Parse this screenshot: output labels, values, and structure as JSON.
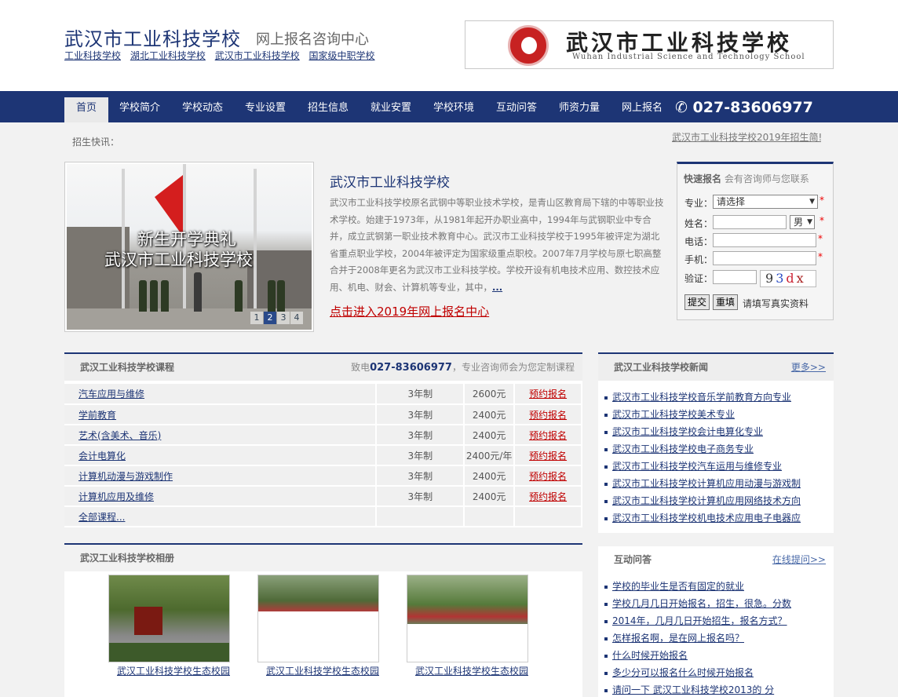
{
  "header": {
    "title": "武汉市工业科技学校",
    "subtitle": "网上报名咨询中心",
    "links": [
      "工业科技学校",
      "湖北工业科技学校",
      "武汉市工业科技学校",
      "国家级中职学校"
    ],
    "logo_cn": "武汉市工业科技学校",
    "logo_en": "Wuhan Industrial Science and Technology School"
  },
  "nav": {
    "items": [
      "首页",
      "学校简介",
      "学校动态",
      "专业设置",
      "招生信息",
      "就业安置",
      "学校环境",
      "互动问答",
      "师资力量",
      "网上报名"
    ],
    "phone": "027-83606977"
  },
  "news_ticker": {
    "label": "招生快讯：",
    "text": "武汉市工业科技学校2019年招生简!"
  },
  "slideshow": {
    "caption_line1": "新生开学典礼",
    "caption_line2": "武汉市工业科技学校",
    "pages": [
      "1",
      "2",
      "3",
      "4"
    ],
    "active_page": 2
  },
  "intro": {
    "title": "武汉市工业科技学校",
    "text": "武汉市工业科技学校原名武钢中等职业技术学校，是青山区教育局下辖的中等职业技术学校。始建于1973年，从1981年起开办职业高中，1994年与武钢职业中专合并，成立武钢第一职业技术教育中心。武汉市工业科技学校于1995年被评定为湖北省重点职业学校，2004年被评定为国家级重点职校。2007年7月学校与原七职高整合并于2008年更名为武汉市工业科技学校。学校开设有机电技术应用、数控技术应用、机电、财会、计算机等专业，其中，",
    "more": "...",
    "link": "点击进入2019年网上报名中心"
  },
  "quick_form": {
    "title": "快速报名",
    "subtitle": "会有咨询师与您联系",
    "major_label": "专业：",
    "major_value": "请选择",
    "name_label": "姓名：",
    "gender_value": "男",
    "phone_label": "电话：",
    "mobile_label": "手机：",
    "captcha_label": "验证：",
    "captcha_chars": [
      "9",
      "3",
      "d",
      "x"
    ],
    "submit": "提交",
    "reset": "重填",
    "hint": "请填写真实资料",
    "required_mark": "*"
  },
  "courses": {
    "title": "武汉工业科技学校课程",
    "phone_prefix": "致电",
    "phone": "027-83606977",
    "phone_suffix": "，专业咨询师会为您定制课程",
    "rows": [
      {
        "name": "汽车应用与维修",
        "duration": "3年制",
        "price": "2600元",
        "action": "预约报名"
      },
      {
        "name": "学前教育",
        "duration": "3年制",
        "price": "2400元",
        "action": "预约报名"
      },
      {
        "name": "艺术(含美术、音乐)",
        "duration": "3年制",
        "price": "2400元",
        "action": "预约报名"
      },
      {
        "name": "会计电算化",
        "duration": "3年制",
        "price": "2400元/年",
        "action": "预约报名"
      },
      {
        "name": "计算机动漫与游戏制作",
        "duration": "3年制",
        "price": "2400元",
        "action": "预约报名"
      },
      {
        "name": "计算机应用及维修",
        "duration": "3年制",
        "price": "2400元",
        "action": "预约报名"
      }
    ],
    "all_link": "全部课程..."
  },
  "school_news": {
    "title": "武汉工业科技学校新闻",
    "more": "更多>>",
    "items": [
      "武汉市工业科技学校音乐学前教育方向专业",
      "武汉市工业科技学校美术专业",
      "武汉市工业科技学校会计电算化专业",
      "武汉市工业科技学校电子商务专业",
      "武汉市工业科技学校汽车运用与维修专业",
      "武汉市工业科技学校计算机应用动漫与游戏制",
      "武汉市工业科技学校计算机应用网络技术方向",
      "武汉市工业科技学校机电技术应用电子电器应"
    ]
  },
  "album": {
    "title": "武汉工业科技学校相册",
    "items": [
      "武汉工业科技学校生态校园",
      "武汉工业科技学校生态校园",
      "武汉工业科技学校生态校园"
    ]
  },
  "qa": {
    "title": "互动问答",
    "more": "在线提问>>",
    "items": [
      "学校的毕业生是否有固定的就业",
      "学校几月几日开始报名，招生，很急。分数",
      "2014年，几月几日开始招生，报名方式？",
      "怎样报名啊，是在网上报名吗？",
      "什么时候开始报名",
      "多少分可以报名什么时候开始报名",
      "请问一下 武汉工业科技学校2013的 分"
    ]
  }
}
